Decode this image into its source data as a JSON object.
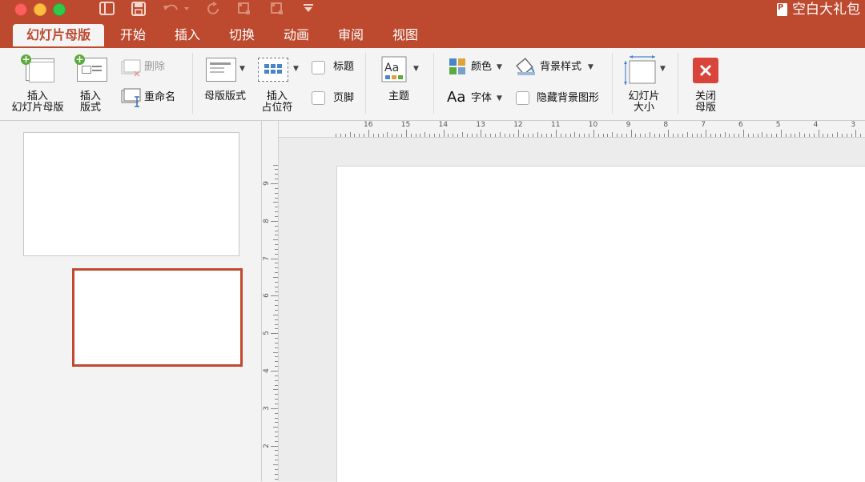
{
  "window": {
    "title": "空白大礼包",
    "app_icon": "powerpoint-doc-icon"
  },
  "quick_access": {
    "icons": [
      "sidebar-icon",
      "save-icon",
      "undo-icon",
      "redo-icon",
      "format-painter-icon",
      "format-painter-2-icon",
      "customize-caret-icon"
    ]
  },
  "tabs": [
    {
      "label": "幻灯片母版",
      "active": true
    },
    {
      "label": "开始",
      "active": false
    },
    {
      "label": "插入",
      "active": false
    },
    {
      "label": "切换",
      "active": false
    },
    {
      "label": "动画",
      "active": false
    },
    {
      "label": "审阅",
      "active": false
    },
    {
      "label": "视图",
      "active": false
    }
  ],
  "ribbon": {
    "insert_master": {
      "line1": "插入",
      "line2": "幻灯片母版"
    },
    "insert_layout": {
      "line1": "插入",
      "line2": "版式"
    },
    "delete": "删除",
    "rename": "重命名",
    "master_layout": "母版版式",
    "insert_placeholder": {
      "line1": "插入",
      "line2": "占位符"
    },
    "title_checkbox": "标题",
    "footer_checkbox": "页脚",
    "theme": "主题",
    "colors": "颜色",
    "fonts": "字体",
    "fonts_icon_text": "Aa",
    "background_styles": "背景样式",
    "hide_background": "隐藏背景图形",
    "slide_size": {
      "line1": "幻灯片",
      "line2": "大小"
    },
    "close_master": {
      "line1": "关闭",
      "line2": "母版"
    }
  },
  "ruler": {
    "horizontal_labels": [
      "16",
      "15",
      "14",
      "13",
      "12",
      "11",
      "10",
      "9",
      "8",
      "7",
      "6",
      "5",
      "4",
      "3"
    ],
    "vertical_labels": [
      "9",
      "8",
      "7",
      "6",
      "5",
      "4",
      "3",
      "2"
    ]
  },
  "accent_color": "#bd4a2f",
  "selection_color": "#c04a2f"
}
